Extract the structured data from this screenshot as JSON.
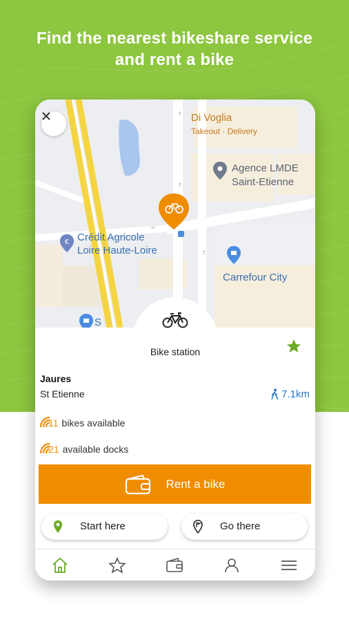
{
  "headline": {
    "line1": "Find the nearest bikeshare service",
    "line2": "and rent a bike"
  },
  "map": {
    "labels": {
      "di_voglia": "Di Voglia",
      "di_voglia_sub": "Takeout · Delivery",
      "agence_line1": "Agence LMDE",
      "agence_line2": "Saint-Etienne",
      "credit_line1": "Crédit Agricole",
      "credit_line2": "Loire Haute-Loire",
      "carrefour": "Carrefour City",
      "partial": "S"
    }
  },
  "station": {
    "type_label": "Bike station",
    "name": "Jaures",
    "city": "St Etienne",
    "distance": "7.1km",
    "bikes_count": "11",
    "bikes_label": "bikes available",
    "docks_count": "21",
    "docks_label": "available docks"
  },
  "actions": {
    "rent_label": "Rent a bike",
    "start_label": "Start here",
    "go_label": "Go there"
  },
  "tabs": [
    "home-icon",
    "star-icon",
    "wallet-icon",
    "user-icon",
    "menu-icon"
  ],
  "colors": {
    "background_green": "#8dc63f",
    "accent_orange": "#f08c00",
    "distance_blue": "#2a78c9",
    "favorite_green": "#6aaa24"
  }
}
